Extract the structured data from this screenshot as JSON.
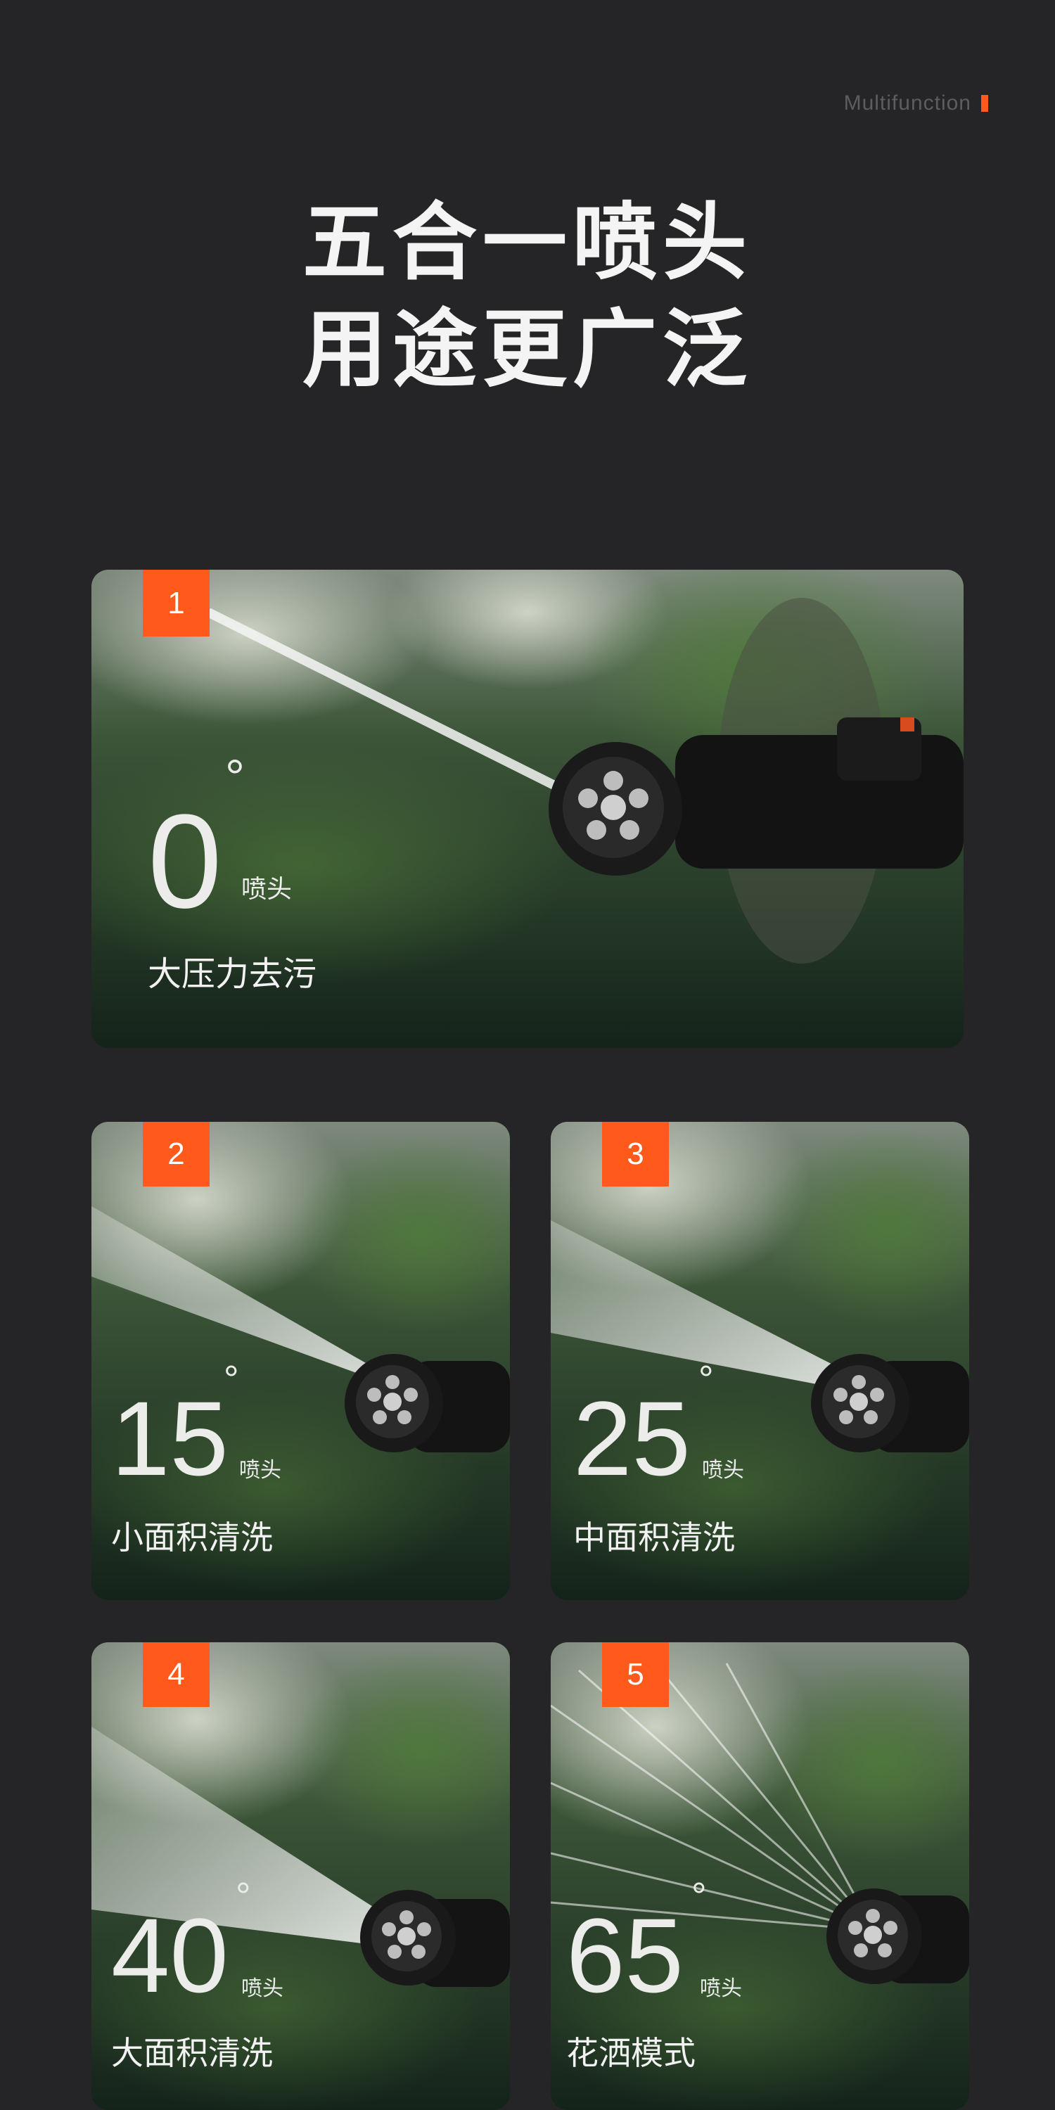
{
  "tag": {
    "text": "Multifunction",
    "color": "#ff5a1c"
  },
  "headline": {
    "line1": "五合一喷头",
    "line2": "用途更广泛"
  },
  "cards": [
    {
      "number": "1",
      "angle": "0",
      "degree": "°",
      "nozzle": "喷头",
      "use": "大压力去污"
    },
    {
      "number": "2",
      "angle": "15",
      "degree": "°",
      "nozzle": "喷头",
      "use": "小面积清洗"
    },
    {
      "number": "3",
      "angle": "25",
      "degree": "°",
      "nozzle": "喷头",
      "use": "中面积清洗"
    },
    {
      "number": "4",
      "angle": "40",
      "degree": "°",
      "nozzle": "喷头",
      "use": "大面积清洗"
    },
    {
      "number": "5",
      "angle": "65",
      "degree": "°",
      "nozzle": "喷头",
      "use": "花洒模式"
    }
  ]
}
